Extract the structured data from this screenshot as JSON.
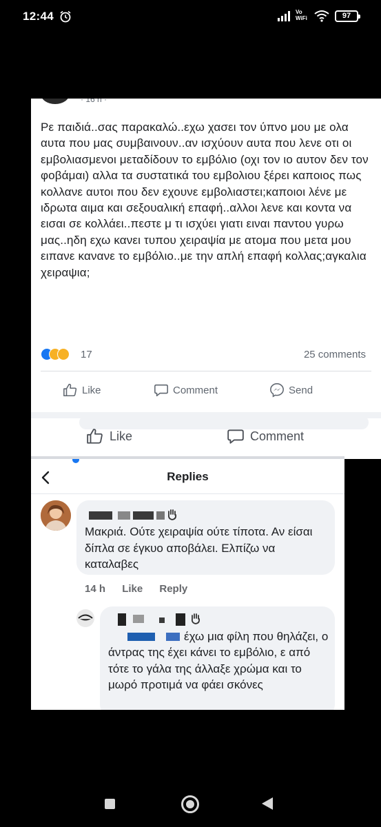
{
  "status_bar": {
    "time": "12:44",
    "network_label_top": "Vo",
    "network_label_bottom": "WiFi",
    "battery": "97"
  },
  "post": {
    "meta": "· 16 h ·",
    "text": "Ρε παιδιά..σας παρακαλώ..εχω χασει τον ύπνο μου με ολα αυτα που μας συμβαινουν..αν ισχύουν αυτα που λενε οτι οι εμβολιασμενοι μεταδίδουν το εμβόλιο (οχι τον ιο αυτον δεν τον φοβάμαι) αλλα τα συστατικά του εμβολιου ξέρει καποιος πως κολλανε αυτοι που δεν εχουνε εμβολιαστει;καποιοι λένε με ιδρωτα αιμα και σεξουαλική επαφή..αλλοι λενε και κοντα να εισαι σε κολλάει..πεστε μ τι ισχύει γιατι ειναι παντου γυρω μας..ηδη εχω κανει τυπου χειραψία με ατομα που μετα μου ειπανε κανανε το εμβόλιο..με την απλή επαφή κολλας;αγκαλια χειραψια;",
    "reaction_count": "17",
    "comments_count": "25 comments",
    "actions": {
      "like": "Like",
      "comment": "Comment",
      "send": "Send"
    },
    "actions2": {
      "like": "Like",
      "comment": "Comment"
    }
  },
  "replies": {
    "title": "Replies",
    "reply1": {
      "text": "Μακριά. Ούτε χειραψία ούτε τίποτα. Αν είσαι δίπλα σε έγκυο αποβάλει. Ελπίζω να καταλαβες",
      "time": "14 h",
      "like": "Like",
      "reply": "Reply"
    },
    "reply2": {
      "text": "έχω μια φίλη που θηλάζει, ο άντρας της έχει κάνει το εμβόλιο, ε από τότε το γάλα της άλλαξε χρώμα και το μωρό προτιμά να φάει σκόνες"
    }
  },
  "colors": {
    "facebook_blue": "#1877f2",
    "meta_gray": "#606770",
    "bubble_bg": "#f0f2f5"
  },
  "icons": [
    "alarm-icon",
    "signal-icon",
    "wifi-icon",
    "like-thumb-icon",
    "comment-bubble-icon",
    "messenger-send-icon",
    "back-chevron-icon",
    "hand-wave-icon"
  ]
}
